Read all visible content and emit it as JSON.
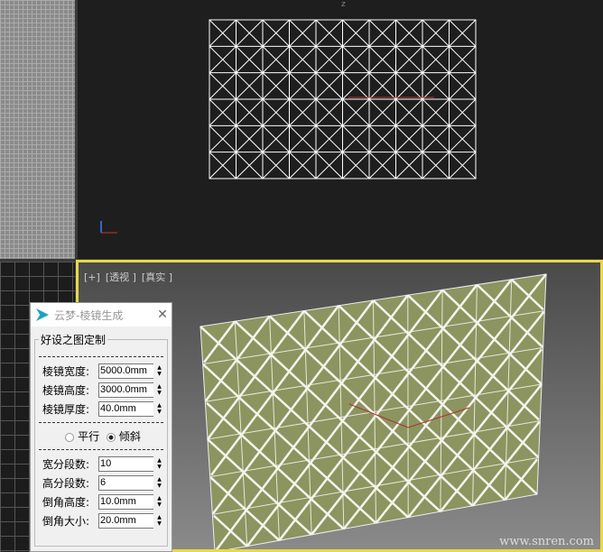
{
  "viewports": {
    "front_axis_label": "z",
    "perspective_label": [
      "[+]",
      "[透视 ]",
      "[真实 ]"
    ]
  },
  "dialog": {
    "title": "云梦-棱镜生成",
    "close_icon": "close-icon",
    "group_label": "好设之图定制",
    "fields1": [
      {
        "label": "棱镜宽度:",
        "value": "5000.0mm"
      },
      {
        "label": "棱镜高度:",
        "value": "3000.0mm"
      },
      {
        "label": "棱镜厚度:",
        "value": "40.0mm"
      }
    ],
    "radio": [
      {
        "label": "平行",
        "checked": false
      },
      {
        "label": "倾斜",
        "checked": true
      }
    ],
    "fields2": [
      {
        "label": "宽分段数:",
        "value": "10"
      },
      {
        "label": "高分段数:",
        "value": "6"
      },
      {
        "label": "倒角高度:",
        "value": "10.0mm"
      },
      {
        "label": "倒角大小:",
        "value": "20.0mm"
      }
    ]
  },
  "watermark": "www.snren.com",
  "colors": {
    "viewport_active": "#e8d84a",
    "plane": "#8c9460"
  }
}
